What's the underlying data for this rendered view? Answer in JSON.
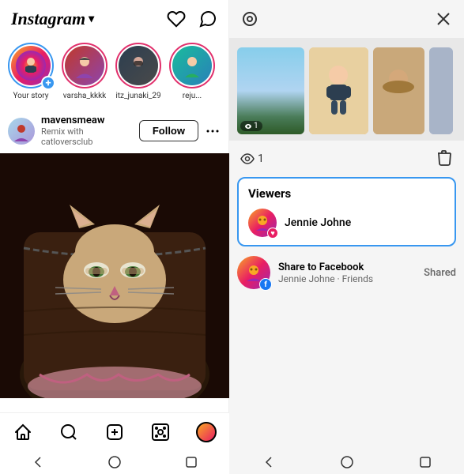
{
  "left": {
    "header": {
      "logo": "Instagram",
      "chevron": "▾"
    },
    "stories": [
      {
        "id": "your-story",
        "label": "Your story",
        "type": "your"
      },
      {
        "id": "varsha",
        "label": "varsha_kkkk",
        "type": "normal"
      },
      {
        "id": "itz",
        "label": "itz_junaki_29",
        "type": "normal"
      },
      {
        "id": "reju",
        "label": "reju...",
        "type": "normal"
      }
    ],
    "post": {
      "username": "mavensmeaw",
      "subtitle": "Remix with catloversclub",
      "follow_btn": "Follow"
    },
    "nav": {
      "items": [
        "home",
        "search",
        "add",
        "reels",
        "profile"
      ]
    },
    "sys_nav": [
      "back",
      "home",
      "square"
    ]
  },
  "right": {
    "close_btn": "✕",
    "viewer_count": "1",
    "eye_icon": "👁",
    "viewers_title": "Viewers",
    "viewer": {
      "name": "Jennie Johne"
    },
    "share": {
      "title": "Share to Facebook",
      "subtitle": "Jennie Johne · Friends",
      "status": "Shared"
    },
    "sys_nav": [
      "back",
      "home",
      "square"
    ]
  }
}
